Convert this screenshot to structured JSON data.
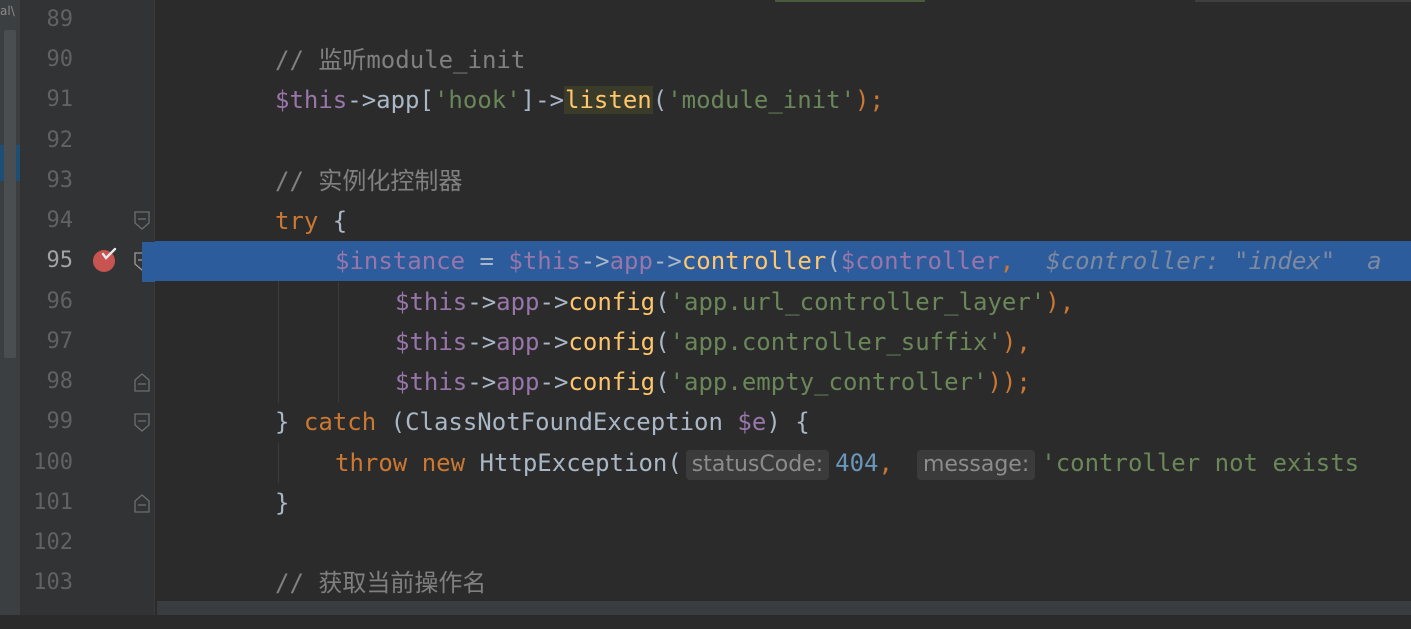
{
  "sidebar": {
    "tab_label": "al\\"
  },
  "gutter": {
    "line_numbers": [
      "89",
      "90",
      "91",
      "92",
      "93",
      "94",
      "95",
      "96",
      "97",
      "98",
      "99",
      "100",
      "101",
      "102",
      "103"
    ],
    "current_line": "95"
  },
  "code": {
    "l90_comment": "// 监听module_init",
    "l91": {
      "this": "$this",
      "arrow": "->",
      "app": "app",
      "open": "[",
      "hook": "'hook'",
      "close": "]->",
      "listen": "listen",
      "paren": "(",
      "module_init": "'module_init'",
      "end": ");"
    },
    "l93_comment": "// 实例化控制器",
    "l94": {
      "try": "try",
      "brace": " {"
    },
    "l95": {
      "instance": "$instance",
      "eq": " = ",
      "this": "$this",
      "arrow1": "->",
      "app": "app",
      "arrow2": "->",
      "controller": "controller",
      "paren": "(",
      "arg": "$controller",
      "comma": ",",
      "inline_value": "$controller: \"index\"",
      "overflow": "a"
    },
    "l96": {
      "this": "$this",
      "arrow1": "->",
      "app": "app",
      "arrow2": "->",
      "config": "config",
      "paren": "(",
      "str": "'app.url_controller_layer'",
      "end": "),"
    },
    "l97": {
      "this": "$this",
      "arrow1": "->",
      "app": "app",
      "arrow2": "->",
      "config": "config",
      "paren": "(",
      "str": "'app.controller_suffix'",
      "end": "),"
    },
    "l98": {
      "this": "$this",
      "arrow1": "->",
      "app": "app",
      "arrow2": "->",
      "config": "config",
      "paren": "(",
      "str": "'app.empty_controller'",
      "end": "));"
    },
    "l99": {
      "close": "} ",
      "catch": "catch",
      "open": " (",
      "cls": "ClassNotFoundException",
      "space": " ",
      "var": "$e",
      "end": ") {"
    },
    "l100": {
      "throw": "throw",
      "new": " new ",
      "cls": "HttpException",
      "paren": "(",
      "hint1": "statusCode:",
      "num": "404",
      "comma": ",",
      "hint2": "message:",
      "str": "'controller not exists"
    },
    "l101": {
      "close": "}"
    },
    "l103_comment": "// 获取当前操作名"
  },
  "colors": {
    "background": "#2b2b2b",
    "gutter": "#313335",
    "execution_line": "#2d5c9c",
    "keyword": "#cc7832",
    "variable": "#9876aa",
    "string": "#6a8759",
    "function": "#ffc66d",
    "number": "#6897bb",
    "comment": "#808080",
    "breakpoint": "#c75450"
  }
}
